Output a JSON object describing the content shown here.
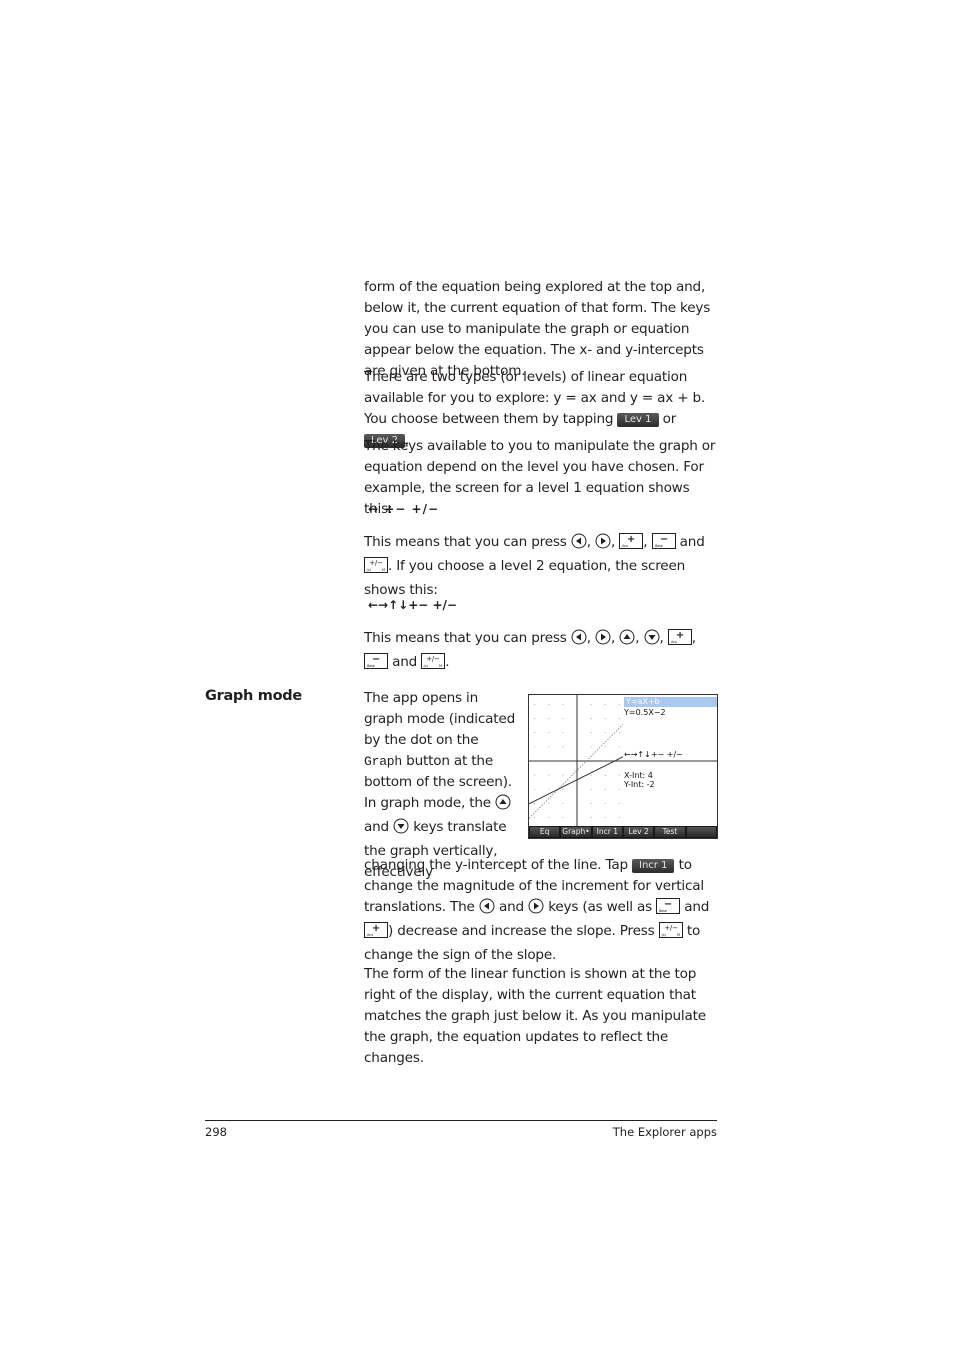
{
  "paragraphs": {
    "p1": "form of the equation being explored at the top and, below it, the current equation of that form. The keys you can use to manipulate the graph or equation appear below the equation. The x- and y-intercepts are given at the bottom.",
    "p2_before": "There are two types (or levels) of linear equation available for you to explore: y = ax and y = ax + b. You choose between them by tapping",
    "p2_or": "or",
    "p2_end": ".",
    "p3": "The keys available to you to manipulate the graph or equation depend on the level you have chosen. For example, the screen for a level 1 equation shows this:",
    "level1_symbols": "↔   +−  +/−",
    "p4_a": "This means that you can press",
    "p4_and": "and",
    "p4_b": ". If you choose a level 2 equation, the screen shows this:",
    "level2_symbols": "←→↑↓+−  +/−",
    "p5_a": "This means that you can press",
    "p5_and": "and",
    "p5_end": ".",
    "gm_1": "The app opens in graph mode (indicated by the dot on the",
    "gm_graph_code": "Graph",
    "gm_2": "button at the bottom of the screen). In graph mode, the",
    "gm_and": "and",
    "gm_3": "keys translate the graph vertically, effectively changing the y-intercept of the line. Tap",
    "gm_4": "to change the magnitude of the increment for vertical translations. The",
    "gm_and2": "and",
    "gm_5": "keys (as well as",
    "gm_and3": "and",
    "gm_6": ") decrease and increase the slope. Press",
    "gm_7": "to change the sign of the slope.",
    "p_last": "The form of the linear function is shown at the top right of the display, with the current equation that matches the graph just below it. As you manipulate the graph, the equation updates to reflect the changes."
  },
  "softkeys": {
    "lev1": "Lev 1",
    "lev2": "Lev 2",
    "incr1": "Incr 1"
  },
  "keys": {
    "plus_key": "+",
    "minus_key": "−",
    "sign_key": "+/−",
    "plus_sub": "Ans",
    "minus_sub": "Base",
    "sign_sub_left": "(x)",
    "sign_sub_right": "M"
  },
  "section_heading": "Graph mode",
  "screenshot": {
    "form": "Y=aX+b",
    "equation": "Y=0.5X−2",
    "key_symbols": "←→↑↓+− +/−",
    "x_int": "X-Int: 4",
    "y_int": "Y-Int: -2",
    "menu": [
      "Eq",
      "Graph•",
      "Incr 1",
      "Lev 2",
      "Test",
      ""
    ],
    "current_line": {
      "slope": 0.5,
      "intercept": -2
    },
    "previous_line": {
      "slope": 1.0,
      "intercept": -1
    },
    "x_range": [
      -5,
      5
    ],
    "y_range": [
      -5,
      5
    ]
  },
  "footer": {
    "page_number": "298",
    "chapter": "The Explorer apps"
  }
}
